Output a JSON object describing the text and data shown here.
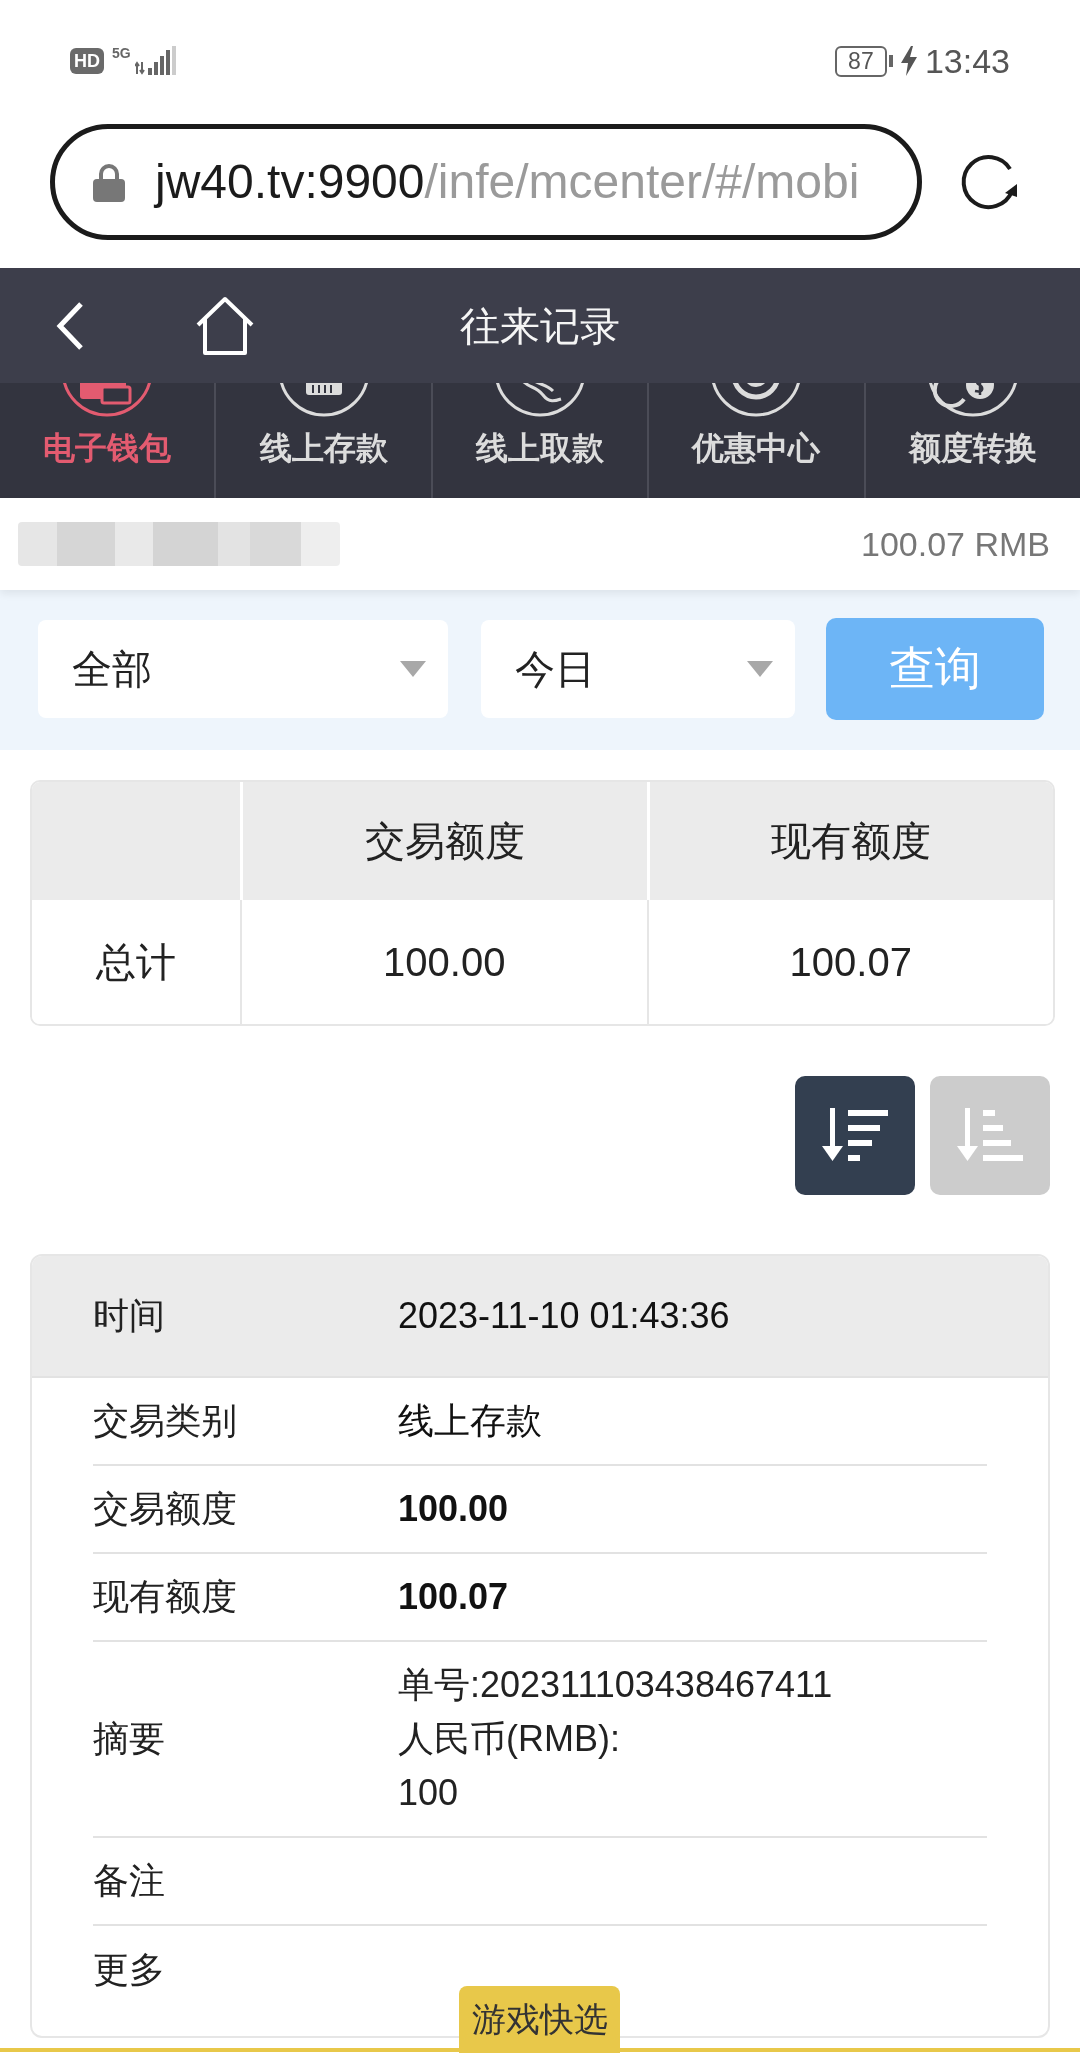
{
  "status_bar": {
    "hd_badge": "HD",
    "network": "5G",
    "battery": "87",
    "time": "13:43"
  },
  "address_bar": {
    "host": "jw40.tv:9900",
    "path": "/infe/mcenter/#/mobi"
  },
  "header": {
    "title": "往来记录"
  },
  "tabs": [
    {
      "label": "电子钱包",
      "selected": true
    },
    {
      "label": "线上存款",
      "selected": false
    },
    {
      "label": "线上取款",
      "selected": false
    },
    {
      "label": "优惠中心",
      "selected": false
    },
    {
      "label": "额度转换",
      "selected": false
    }
  ],
  "account": {
    "balance": "100.07 RMB"
  },
  "filters": {
    "type": {
      "value": "全部"
    },
    "period": {
      "value": "今日"
    },
    "search_button": "查询"
  },
  "summary_table": {
    "columns": [
      "交易额度",
      "现有额度"
    ],
    "rows": [
      {
        "label": "总计",
        "cells": [
          "100.00",
          "100.07"
        ]
      }
    ]
  },
  "sort_buttons": [
    {
      "kind": "descending",
      "selected": true
    },
    {
      "kind": "ascending",
      "selected": false
    }
  ],
  "record": {
    "header": {
      "label": "时间",
      "value": "2023-11-10 01:43:36"
    },
    "rows": [
      {
        "label": "交易类别",
        "value": "线上存款",
        "bold": false
      },
      {
        "label": "交易额度",
        "value": "100.00",
        "bold": true
      },
      {
        "label": "现有额度",
        "value": "100.07",
        "bold": true
      },
      {
        "label": "摘要",
        "lines": [
          "单号:202311103438467411",
          "人民币(RMB):",
          "100"
        ]
      },
      {
        "label": "备注"
      },
      {
        "label": "更多"
      }
    ]
  },
  "floating_tab": {
    "label": "游戏快选"
  }
}
